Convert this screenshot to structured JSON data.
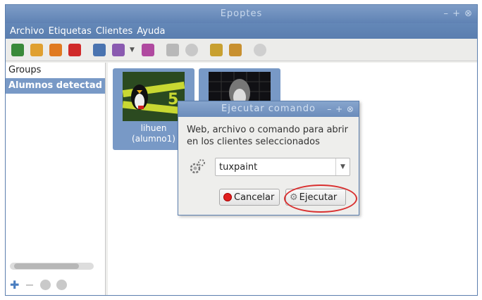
{
  "window": {
    "title": "Epoptes",
    "controls": "– + ⊗"
  },
  "menu": [
    "Archivo",
    "Etiquetas",
    "Clientes",
    "Ayuda"
  ],
  "toolbar": {
    "icons": [
      {
        "name": "wake-on-lan-icon",
        "color": "#3a8a3a"
      },
      {
        "name": "logout-icon",
        "color": "#e0a030"
      },
      {
        "name": "reboot-icon",
        "color": "#e07a20"
      },
      {
        "name": "shutdown-icon",
        "color": "#d02a2a"
      },
      {
        "name": "assist-icon",
        "color": "#4a74b0"
      },
      {
        "name": "broadcast-icon",
        "color": "#8a5ab0"
      },
      {
        "name": "stop-broadcast-icon",
        "color": "#b04aa0"
      },
      {
        "name": "execute-icon",
        "color": "#b8b8b8"
      },
      {
        "name": "message-icon",
        "color": "#c8c8c8"
      },
      {
        "name": "lock-screen-icon",
        "color": "#c8a030"
      },
      {
        "name": "unlock-screen-icon",
        "color": "#c89030"
      },
      {
        "name": "info-icon",
        "color": "#cfcfcf"
      }
    ]
  },
  "sidebar": {
    "groups_label": "Groups",
    "selected": "Alumnos detectad"
  },
  "clients": [
    {
      "name": "lihuen",
      "user": "(alumno1)"
    }
  ],
  "dialog": {
    "title": "Ejecutar comando",
    "controls": "– + ⊗",
    "message": "Web, archivo o comando para abrir en los clientes seleccionados",
    "command_value": "tuxpaint",
    "cancel_label": "Cancelar",
    "execute_label": "Ejecutar"
  }
}
